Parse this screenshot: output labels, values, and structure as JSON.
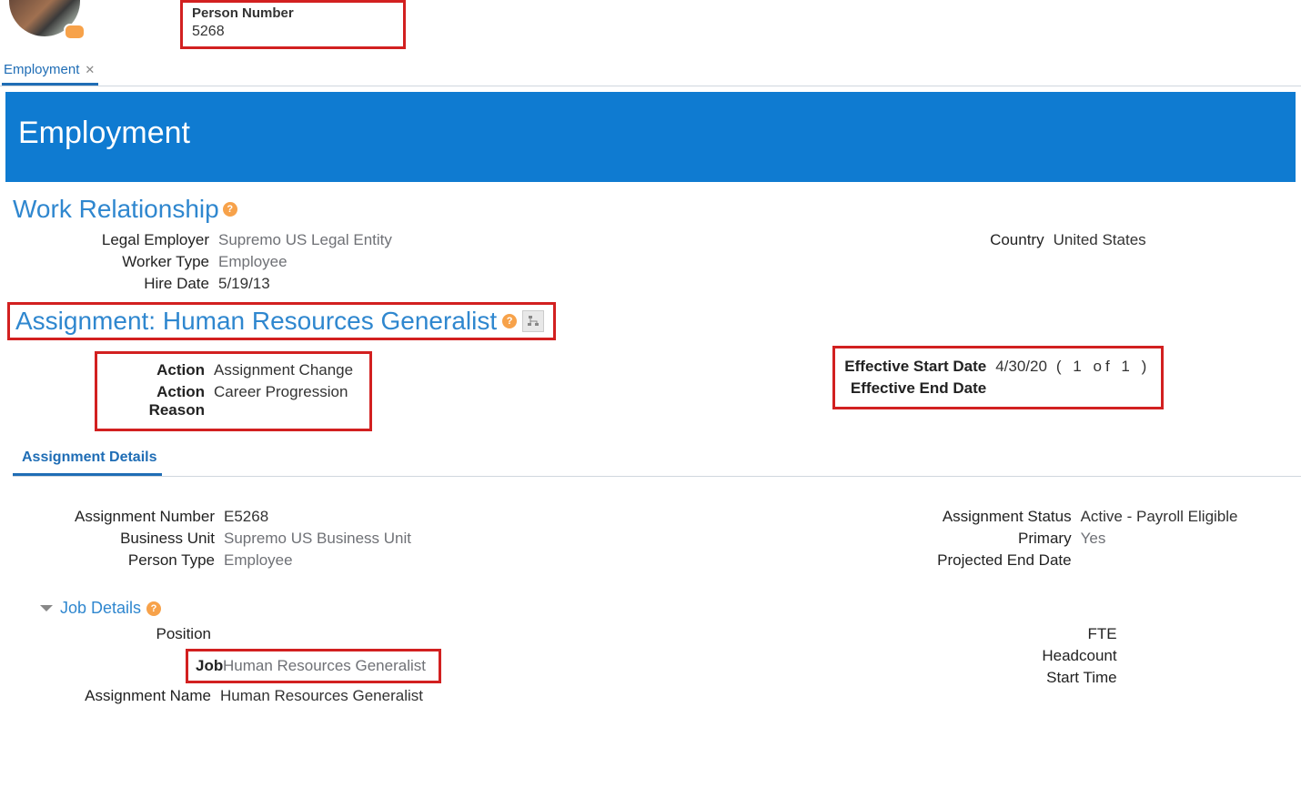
{
  "header": {
    "person_number_label": "Person Number",
    "person_number_value": "5268",
    "tab_label": "Employment"
  },
  "banner": {
    "title": "Employment"
  },
  "work_relationship": {
    "title": "Work Relationship",
    "legal_employer": {
      "label": "Legal Employer",
      "value": "Supremo US Legal Entity"
    },
    "worker_type": {
      "label": "Worker Type",
      "value": "Employee"
    },
    "hire_date": {
      "label": "Hire Date",
      "value": "5/19/13"
    },
    "country": {
      "label": "Country",
      "value": "United States"
    }
  },
  "assignment": {
    "title": "Assignment: Human Resources Generalist",
    "action": {
      "label": "Action",
      "value": "Assignment Change"
    },
    "action_reason": {
      "label": "Action Reason",
      "value": "Career Progression"
    },
    "eff_start": {
      "label": "Effective Start Date",
      "value": "4/30/20"
    },
    "pager": "(  1 of 1  )",
    "eff_end": {
      "label": "Effective End Date",
      "value": ""
    },
    "subtab": "Assignment Details"
  },
  "details": {
    "assignment_number": {
      "label": "Assignment Number",
      "value": "E5268"
    },
    "business_unit": {
      "label": "Business Unit",
      "value": "Supremo US Business Unit"
    },
    "person_type": {
      "label": "Person Type",
      "value": "Employee"
    },
    "assignment_status": {
      "label": "Assignment Status",
      "value": "Active - Payroll Eligible"
    },
    "primary": {
      "label": "Primary",
      "value": "Yes"
    },
    "projected_end": {
      "label": "Projected End Date",
      "value": ""
    },
    "job_section": "Job Details",
    "position": {
      "label": "Position",
      "value": ""
    },
    "job": {
      "label": "Job",
      "value": "Human Resources Generalist"
    },
    "assignment_name": {
      "label": "Assignment Name",
      "value": "Human Resources Generalist"
    },
    "fte": {
      "label": "FTE",
      "value": ""
    },
    "headcount": {
      "label": "Headcount",
      "value": ""
    },
    "start_time": {
      "label": "Start Time",
      "value": ""
    }
  }
}
